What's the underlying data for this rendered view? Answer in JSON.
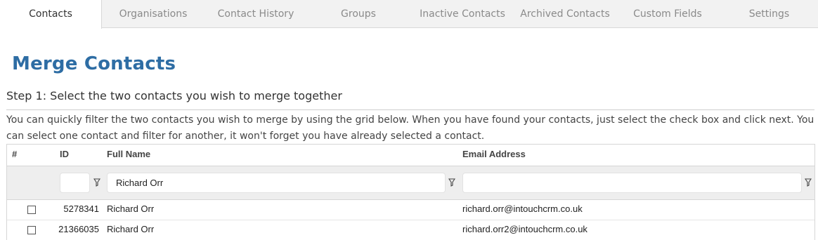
{
  "tabs": [
    {
      "label": "Contacts",
      "active": true
    },
    {
      "label": "Organisations",
      "active": false
    },
    {
      "label": "Contact History",
      "active": false
    },
    {
      "label": "Groups",
      "active": false
    },
    {
      "label": "Inactive Contacts",
      "active": false
    },
    {
      "label": "Archived Contacts",
      "active": false
    },
    {
      "label": "Custom Fields",
      "active": false
    },
    {
      "label": "Settings",
      "active": false
    }
  ],
  "page": {
    "title": "Merge Contacts",
    "step": "Step 1: Select the two contacts you wish to merge together",
    "description": "You can quickly filter the two contacts you wish to merge by using the grid below. When you have found your contacts, just select the check box and click next. You can select one contact and filter for another, it won't forget you have already selected a contact."
  },
  "grid": {
    "columns": {
      "select": "#",
      "id": "ID",
      "full_name": "Full Name",
      "email": "Email Address"
    },
    "filters": {
      "id": "",
      "full_name": "Richard Orr",
      "email": ""
    },
    "rows": [
      {
        "checked": false,
        "id": "5278341",
        "full_name": "Richard Orr",
        "email": "richard.orr@intouchcrm.co.uk"
      },
      {
        "checked": false,
        "id": "21366035",
        "full_name": "Richard Orr",
        "email": "richard.orr2@intouchcrm.co.uk"
      }
    ]
  },
  "icons": {
    "filter": "funnel-icon"
  },
  "colors": {
    "title": "#2e6da4",
    "tab_bar": "#f2f2f2"
  }
}
